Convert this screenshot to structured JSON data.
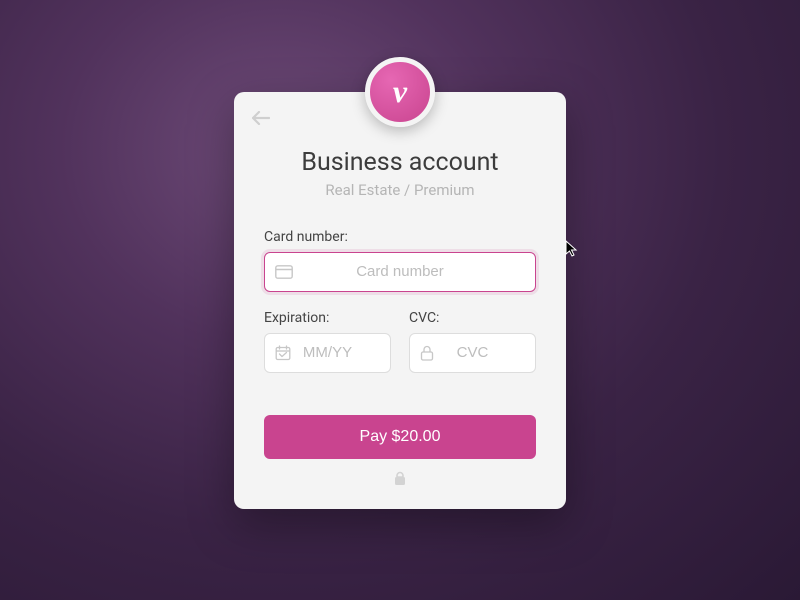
{
  "logo": {
    "letter": "v"
  },
  "header": {
    "title": "Business account",
    "subtitle": "Real Estate / Premium"
  },
  "fields": {
    "card_number": {
      "label": "Card number:",
      "placeholder": "Card number",
      "value": ""
    },
    "expiration": {
      "label": "Expiration:",
      "placeholder": "MM/YY",
      "value": ""
    },
    "cvc": {
      "label": "CVC:",
      "placeholder": "CVC",
      "value": ""
    }
  },
  "button": {
    "pay_label": "Pay $20.00"
  }
}
